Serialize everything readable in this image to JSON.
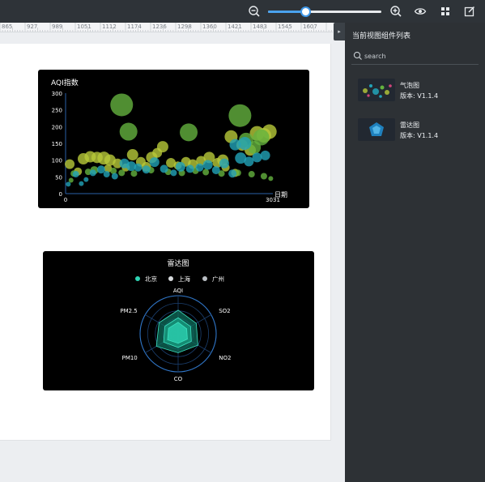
{
  "toolbar": {
    "zoom": {
      "value_fraction": 0.33
    },
    "icons": [
      "zoom-out-icon",
      "zoom-in-icon",
      "eye-icon",
      "grid-icon",
      "edit-icon"
    ]
  },
  "ruler": {
    "ticks": [
      "865",
      "927",
      "989",
      "1051",
      "1112",
      "1174",
      "1236",
      "1298",
      "1360",
      "1421",
      "1483",
      "1545",
      "1607"
    ]
  },
  "panel": {
    "title": "当前视图组件列表",
    "search": {
      "placeholder": "search",
      "value": ""
    },
    "items": [
      {
        "name": "气泡图",
        "version": "版本: V1.1.4",
        "thumb": "bubble"
      },
      {
        "name": "雷达图",
        "version": "版本: V1.1.4",
        "thumb": "radar"
      }
    ]
  },
  "colors": {
    "toolbar_bg": "#2e3338",
    "panel_bg": "#2d3135",
    "accent": "#3e96e6",
    "chart_bg": "#000000"
  },
  "chart_data": [
    {
      "type": "scatter",
      "title": "AQI指数",
      "xlabel": "日期",
      "ylabel": "",
      "xlim": [
        0,
        3031
      ],
      "ylim": [
        0,
        300
      ],
      "x_ticks": [
        "0",
        "3031"
      ],
      "y_ticks": [
        "0",
        "50",
        "100",
        "150",
        "200",
        "250",
        "300"
      ],
      "grid": false,
      "series": [
        {
          "color": "#b8c93a",
          "points": [
            {
              "x": 60,
              "y": 88,
              "r": 6
            },
            {
              "x": 180,
              "y": 66,
              "r": 5
            },
            {
              "x": 260,
              "y": 104,
              "r": 7
            },
            {
              "x": 360,
              "y": 110,
              "r": 7
            },
            {
              "x": 460,
              "y": 108,
              "r": 7
            },
            {
              "x": 560,
              "y": 106,
              "r": 8
            },
            {
              "x": 650,
              "y": 100,
              "r": 7
            },
            {
              "x": 760,
              "y": 90,
              "r": 6
            },
            {
              "x": 880,
              "y": 78,
              "r": 5
            },
            {
              "x": 980,
              "y": 116,
              "r": 7
            },
            {
              "x": 1100,
              "y": 95,
              "r": 6
            },
            {
              "x": 1180,
              "y": 80,
              "r": 6
            },
            {
              "x": 1260,
              "y": 108,
              "r": 7
            },
            {
              "x": 1340,
              "y": 122,
              "r": 6
            },
            {
              "x": 1420,
              "y": 140,
              "r": 7
            },
            {
              "x": 1540,
              "y": 92,
              "r": 6
            },
            {
              "x": 1640,
              "y": 84,
              "r": 5
            },
            {
              "x": 1760,
              "y": 95,
              "r": 6
            },
            {
              "x": 1860,
              "y": 88,
              "r": 6
            },
            {
              "x": 1980,
              "y": 98,
              "r": 6
            },
            {
              "x": 2100,
              "y": 108,
              "r": 7
            },
            {
              "x": 2220,
              "y": 92,
              "r": 6
            },
            {
              "x": 2340,
              "y": 78,
              "r": 5
            },
            {
              "x": 2420,
              "y": 170,
              "r": 8
            },
            {
              "x": 2480,
              "y": 62,
              "r": 5
            },
            {
              "x": 2580,
              "y": 145,
              "r": 7
            },
            {
              "x": 2700,
              "y": 130,
              "r": 7
            },
            {
              "x": 2800,
              "y": 180,
              "r": 9
            },
            {
              "x": 2900,
              "y": 174,
              "r": 9
            },
            {
              "x": 2980,
              "y": 185,
              "r": 9
            },
            {
              "x": 2300,
              "y": 100,
              "r": 7
            },
            {
              "x": 620,
              "y": 75,
              "r": 5
            }
          ]
        },
        {
          "color": "#64b23f",
          "points": [
            {
              "x": 120,
              "y": 60,
              "r": 4
            },
            {
              "x": 330,
              "y": 65,
              "r": 4
            },
            {
              "x": 420,
              "y": 70,
              "r": 5
            },
            {
              "x": 700,
              "y": 68,
              "r": 4
            },
            {
              "x": 820,
              "y": 62,
              "r": 4
            },
            {
              "x": 1000,
              "y": 60,
              "r": 4
            },
            {
              "x": 1250,
              "y": 70,
              "r": 4
            },
            {
              "x": 1500,
              "y": 65,
              "r": 4
            },
            {
              "x": 1700,
              "y": 62,
              "r": 4
            },
            {
              "x": 1900,
              "y": 68,
              "r": 4
            },
            {
              "x": 2050,
              "y": 64,
              "r": 4
            },
            {
              "x": 2280,
              "y": 60,
              "r": 4
            },
            {
              "x": 2520,
              "y": 62,
              "r": 4
            },
            {
              "x": 2720,
              "y": 58,
              "r": 4
            },
            {
              "x": 2900,
              "y": 52,
              "r": 4
            },
            {
              "x": 1800,
              "y": 183,
              "r": 11
            },
            {
              "x": 920,
              "y": 185,
              "r": 11
            },
            {
              "x": 820,
              "y": 265,
              "r": 14
            },
            {
              "x": 2550,
              "y": 233,
              "r": 14
            },
            {
              "x": 2640,
              "y": 160,
              "r": 9
            },
            {
              "x": 2860,
              "y": 168,
              "r": 10
            },
            {
              "x": 2760,
              "y": 138,
              "r": 8
            },
            {
              "x": 80,
              "y": 40,
              "r": 3
            },
            {
              "x": 3000,
              "y": 45,
              "r": 3
            }
          ]
        },
        {
          "color": "#22a3b8",
          "points": [
            {
              "x": 40,
              "y": 28,
              "r": 3
            },
            {
              "x": 150,
              "y": 58,
              "r": 4
            },
            {
              "x": 300,
              "y": 42,
              "r": 3
            },
            {
              "x": 400,
              "y": 62,
              "r": 4
            },
            {
              "x": 520,
              "y": 72,
              "r": 5
            },
            {
              "x": 600,
              "y": 58,
              "r": 4
            },
            {
              "x": 720,
              "y": 52,
              "r": 4
            },
            {
              "x": 860,
              "y": 90,
              "r": 6
            },
            {
              "x": 960,
              "y": 82,
              "r": 6
            },
            {
              "x": 1060,
              "y": 78,
              "r": 5
            },
            {
              "x": 1180,
              "y": 72,
              "r": 5
            },
            {
              "x": 1300,
              "y": 94,
              "r": 6
            },
            {
              "x": 1440,
              "y": 74,
              "r": 5
            },
            {
              "x": 1580,
              "y": 62,
              "r": 4
            },
            {
              "x": 1680,
              "y": 80,
              "r": 6
            },
            {
              "x": 1820,
              "y": 74,
              "r": 5
            },
            {
              "x": 1960,
              "y": 78,
              "r": 5
            },
            {
              "x": 2080,
              "y": 86,
              "r": 6
            },
            {
              "x": 2200,
              "y": 70,
              "r": 5
            },
            {
              "x": 2320,
              "y": 90,
              "r": 6
            },
            {
              "x": 2440,
              "y": 60,
              "r": 5
            },
            {
              "x": 2560,
              "y": 106,
              "r": 7
            },
            {
              "x": 2680,
              "y": 96,
              "r": 6
            },
            {
              "x": 2800,
              "y": 108,
              "r": 6
            },
            {
              "x": 2920,
              "y": 114,
              "r": 6
            },
            {
              "x": 2620,
              "y": 150,
              "r": 8
            },
            {
              "x": 2480,
              "y": 146,
              "r": 7
            },
            {
              "x": 230,
              "y": 30,
              "r": 3
            }
          ]
        }
      ]
    },
    {
      "type": "radar",
      "title": "雷达图",
      "indicators": [
        "AQI",
        "SO2",
        "NO2",
        "CO",
        "PM10",
        "PM2.5"
      ],
      "legend": [
        "北京",
        "上海",
        "广州"
      ],
      "legend_colors": [
        "#2ed3b3",
        "#d7dadd",
        "#b9bec3"
      ],
      "legend_position": "top-center",
      "series": [
        {
          "name": "北京",
          "values": [
            0.62,
            0.55,
            0.6,
            0.5,
            0.66,
            0.58
          ]
        },
        {
          "name": "上海",
          "values": [
            0.42,
            0.38,
            0.4,
            0.36,
            0.44,
            0.4
          ]
        },
        {
          "name": "广州",
          "values": [
            0.3,
            0.26,
            0.28,
            0.25,
            0.32,
            0.29
          ]
        }
      ]
    }
  ]
}
